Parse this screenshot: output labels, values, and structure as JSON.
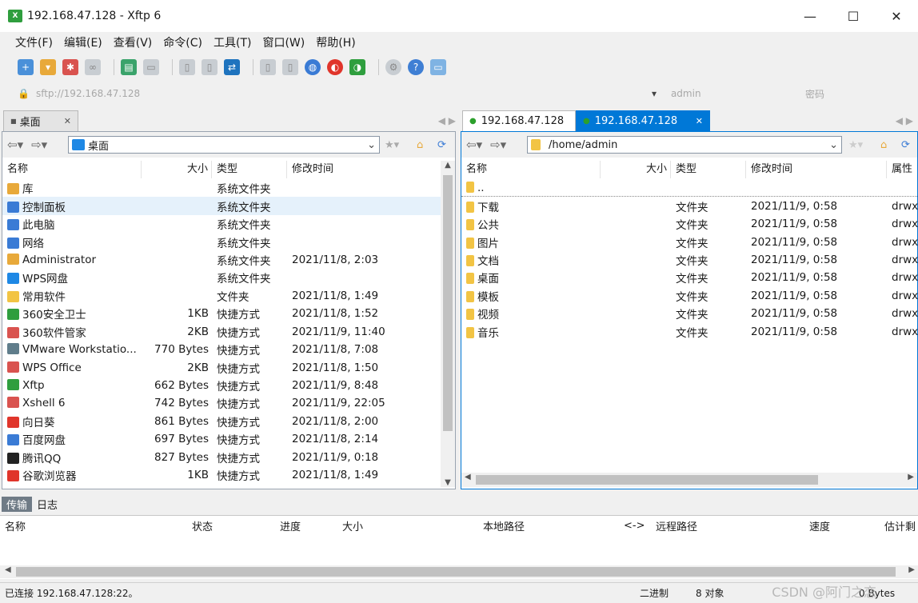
{
  "window": {
    "title": "192.168.47.128 - Xftp 6"
  },
  "menu": [
    "文件(F)",
    "编辑(E)",
    "查看(V)",
    "命令(C)",
    "工具(T)",
    "窗口(W)",
    "帮助(H)"
  ],
  "address": {
    "url": "sftp://192.168.47.128",
    "user": "admin",
    "password_placeholder": "密码"
  },
  "left_tab": {
    "label": "桌面"
  },
  "right_tabs": [
    {
      "label": "192.168.47.128"
    },
    {
      "label": "192.168.47.128"
    }
  ],
  "left_path": "桌面",
  "right_path": "/home/admin",
  "left_columns": [
    "名称",
    "大小",
    "类型",
    "修改时间"
  ],
  "right_columns": [
    "名称",
    "大小",
    "类型",
    "修改时间",
    "属性"
  ],
  "left_rows": [
    {
      "name": "库",
      "size": "",
      "type": "系统文件夹",
      "date": ""
    },
    {
      "name": "控制面板",
      "size": "",
      "type": "系统文件夹",
      "date": ""
    },
    {
      "name": "此电脑",
      "size": "",
      "type": "系统文件夹",
      "date": ""
    },
    {
      "name": "网络",
      "size": "",
      "type": "系统文件夹",
      "date": ""
    },
    {
      "name": "Administrator",
      "size": "",
      "type": "系统文件夹",
      "date": "2021/11/8, 2:03"
    },
    {
      "name": "WPS网盘",
      "size": "",
      "type": "系统文件夹",
      "date": ""
    },
    {
      "name": "常用软件",
      "size": "",
      "type": "文件夹",
      "date": "2021/11/8, 1:49"
    },
    {
      "name": "360安全卫士",
      "size": "1KB",
      "type": "快捷方式",
      "date": "2021/11/8, 1:52"
    },
    {
      "name": "360软件管家",
      "size": "2KB",
      "type": "快捷方式",
      "date": "2021/11/9, 11:40"
    },
    {
      "name": "VMware Workstatio...",
      "size": "770 Bytes",
      "type": "快捷方式",
      "date": "2021/11/8, 7:08"
    },
    {
      "name": "WPS Office",
      "size": "2KB",
      "type": "快捷方式",
      "date": "2021/11/8, 1:50"
    },
    {
      "name": "Xftp",
      "size": "662 Bytes",
      "type": "快捷方式",
      "date": "2021/11/9, 8:48"
    },
    {
      "name": "Xshell 6",
      "size": "742 Bytes",
      "type": "快捷方式",
      "date": "2021/11/9, 22:05"
    },
    {
      "name": "向日葵",
      "size": "861 Bytes",
      "type": "快捷方式",
      "date": "2021/11/8, 2:00"
    },
    {
      "name": "百度网盘",
      "size": "697 Bytes",
      "type": "快捷方式",
      "date": "2021/11/8, 2:14"
    },
    {
      "name": "腾讯QQ",
      "size": "827 Bytes",
      "type": "快捷方式",
      "date": "2021/11/9, 0:18"
    },
    {
      "name": "谷歌浏览器",
      "size": "1KB",
      "type": "快捷方式",
      "date": "2021/11/8, 1:49"
    }
  ],
  "right_rows": [
    {
      "name": "..",
      "size": "",
      "type": "",
      "date": "",
      "attr": ""
    },
    {
      "name": "下载",
      "size": "",
      "type": "文件夹",
      "date": "2021/11/9, 0:58",
      "attr": "drwx"
    },
    {
      "name": "公共",
      "size": "",
      "type": "文件夹",
      "date": "2021/11/9, 0:58",
      "attr": "drwx"
    },
    {
      "name": "图片",
      "size": "",
      "type": "文件夹",
      "date": "2021/11/9, 0:58",
      "attr": "drwx"
    },
    {
      "name": "文档",
      "size": "",
      "type": "文件夹",
      "date": "2021/11/9, 0:58",
      "attr": "drwx"
    },
    {
      "name": "桌面",
      "size": "",
      "type": "文件夹",
      "date": "2021/11/9, 0:58",
      "attr": "drwx"
    },
    {
      "name": "模板",
      "size": "",
      "type": "文件夹",
      "date": "2021/11/9, 0:58",
      "attr": "drwx"
    },
    {
      "name": "视频",
      "size": "",
      "type": "文件夹",
      "date": "2021/11/9, 0:58",
      "attr": "drwx"
    },
    {
      "name": "音乐",
      "size": "",
      "type": "文件夹",
      "date": "2021/11/9, 0:58",
      "attr": "drwx"
    }
  ],
  "bottom_tabs": [
    "传输",
    "日志"
  ],
  "transfer_columns": [
    "名称",
    "状态",
    "进度",
    "大小",
    "本地路径",
    "<->",
    "远程路径",
    "速度",
    "估计剩"
  ],
  "status": {
    "left": "已连接 192.168.47.128:22。",
    "mode": "二进制",
    "objects": "8 对象",
    "bytes": "0 Bytes"
  },
  "watermark": "CSDN @阿门之恋",
  "colors": {
    "accent_tab": "#0078d7",
    "folder": "#f2c444",
    "selected_row": "#e5f1fb"
  }
}
